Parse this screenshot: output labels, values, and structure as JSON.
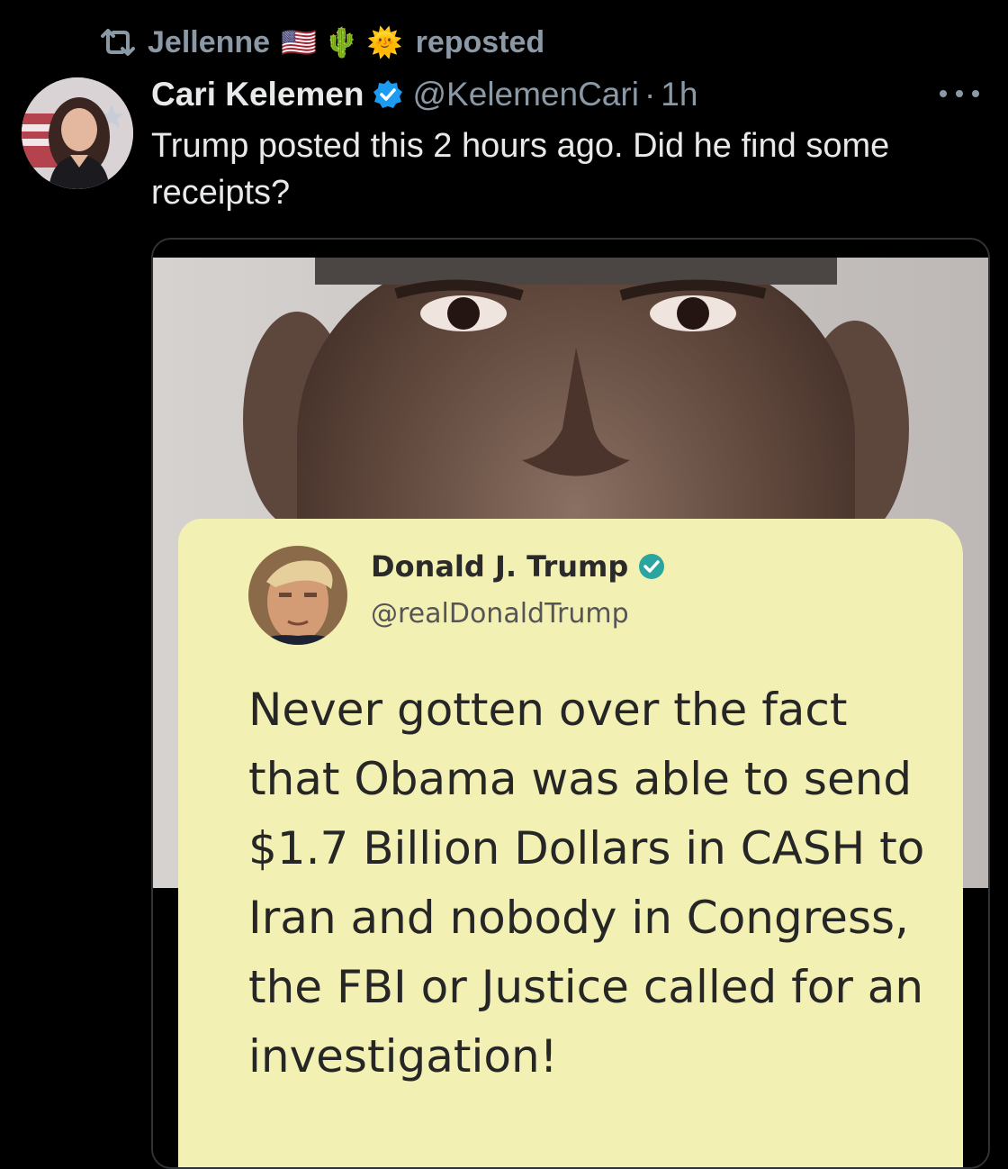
{
  "repost": {
    "icon": "retweet-icon",
    "name": "Jellenne",
    "emojis": [
      "🇺🇸",
      "🌵",
      "🌞"
    ],
    "label": "reposted"
  },
  "post": {
    "author": {
      "display_name": "Cari Kelemen",
      "verified": true,
      "handle": "@KelemenCari",
      "separator": "·",
      "time": "1h"
    },
    "text": "Trump posted this 2 hours ago. Did he find some receipts?",
    "media": {
      "embedded_tweet": {
        "display_name": "Donald J. Trump",
        "handle": "@realDonaldTrump",
        "verified": true,
        "text": "Never gotten over the fact that Obama was able to send $1.7 Billion Dollars in CASH to Iran and nobody in Congress, the FBI or Justice called for an investigation!"
      }
    }
  },
  "colors": {
    "background": "#000000",
    "text_primary": "#e7e9ea",
    "text_secondary": "#8b98a5",
    "verified_blue": "#1d9bf0",
    "note_background": "#f3f0b3",
    "trump_verified": "#2aa5a0"
  }
}
